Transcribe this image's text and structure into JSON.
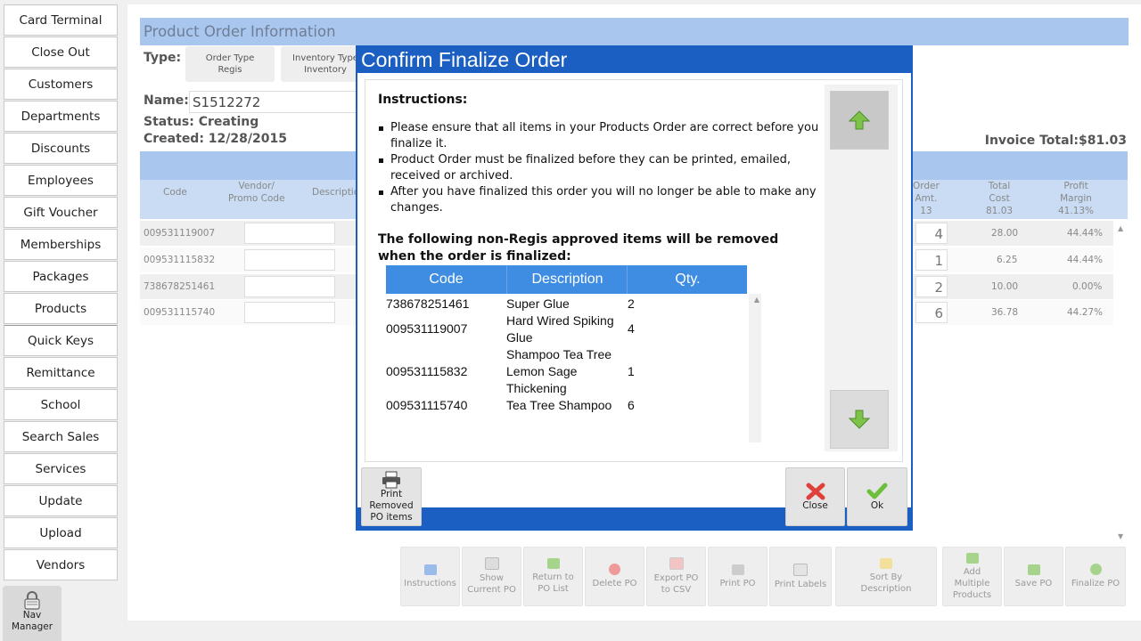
{
  "sidebar": {
    "items": [
      {
        "label": "Card Terminal"
      },
      {
        "label": "Close Out"
      },
      {
        "label": "Customers"
      },
      {
        "label": "Departments"
      },
      {
        "label": "Discounts"
      },
      {
        "label": "Employees"
      },
      {
        "label": "Gift Voucher"
      },
      {
        "label": "Memberships"
      },
      {
        "label": "Packages"
      },
      {
        "label": "Products"
      },
      {
        "label": "Quick Keys"
      },
      {
        "label": "Remittance"
      },
      {
        "label": "School"
      },
      {
        "label": "Search Sales"
      },
      {
        "label": "Services"
      },
      {
        "label": "Update"
      },
      {
        "label": "Upload"
      },
      {
        "label": "Vendors"
      }
    ],
    "nav_manager": {
      "line1": "Nav",
      "line2": "Manager",
      "icon": "lock-icon"
    }
  },
  "order": {
    "header": "Product Order Information",
    "type_label": "Type:",
    "order_type": {
      "title": "Order Type",
      "value": "Regis"
    },
    "inventory_type": {
      "title": "Inventory Type",
      "value": "Inventory"
    },
    "name_label": "Name:",
    "name_value": "S1512272",
    "status": "Status: Creating",
    "created": "Created: 12/28/2015",
    "invoice_total": "Invoice Total:$81.03"
  },
  "grid": {
    "headers": {
      "code": "Code",
      "vendor_l1": "Vendor/",
      "vendor_l2": "Promo Code",
      "description": "Description",
      "order_l1": "Order",
      "order_l2": "Amt.",
      "order_total": "13",
      "cost_l1": "Total",
      "cost_l2": "Cost",
      "cost_total": "81.03",
      "margin_l1": "Profit",
      "margin_l2": "Margin",
      "margin_total": "41.13%"
    },
    "rows": [
      {
        "code": "009531119007",
        "amt": "4",
        "cost": "28.00",
        "margin": "44.44%"
      },
      {
        "code": "009531115832",
        "amt": "1",
        "cost": "6.25",
        "margin": "44.44%"
      },
      {
        "code": "738678251461",
        "amt": "2",
        "cost": "10.00",
        "margin": "0.00%"
      },
      {
        "code": "009531115740",
        "amt": "6",
        "cost": "36.78",
        "margin": "44.27%"
      }
    ]
  },
  "toolbar": {
    "instructions": "Instructions",
    "show_current_l1": "Show",
    "show_current_l2": "Current PO",
    "return_l1": "Return to",
    "return_l2": "PO List",
    "delete": "Delete PO",
    "export_l1": "Export PO",
    "export_l2": "to CSV",
    "print": "Print PO",
    "print_labels": "Print Labels",
    "sort_l1": "Sort By",
    "sort_l2": "Description",
    "add_l1": "Add",
    "add_l2": "Multiple",
    "add_l3": "Products",
    "save": "Save PO",
    "finalize": "Finalize PO"
  },
  "modal": {
    "title": "Confirm Finalize Order",
    "instructions_title": "Instructions:",
    "instructions": [
      "Please ensure that all items in your Products Order are correct before you finalize it.",
      "Product Order must be finalized before they can be printed, emailed, received or archived.",
      "After you have finalized this order you will no longer be able to make any changes."
    ],
    "warning": "The following non-Regis approved items will be removed when the order is finalized:",
    "table_headers": {
      "code": "Code",
      "description": "Description",
      "qty": "Qty."
    },
    "removed_items": [
      {
        "code": "738678251461",
        "desc1": "Super Glue",
        "desc2": "",
        "desc3": "",
        "qty": "2"
      },
      {
        "code": "009531119007",
        "desc1": "Hard Wired Spiking",
        "desc2": "Glue",
        "desc3": "",
        "qty": "4"
      },
      {
        "code": "009531115832",
        "desc1": "Shampoo Tea Tree",
        "desc2": "Lemon Sage",
        "desc3": "Thickening",
        "qty": "1"
      },
      {
        "code": "009531115740",
        "desc1": "Tea Tree Shampoo",
        "desc2": "",
        "desc3": "",
        "qty": "6"
      }
    ],
    "print_removed_l1": "Print",
    "print_removed_l2": "Removed",
    "print_removed_l3": "PO items",
    "close": "Close",
    "ok": "Ok"
  },
  "colors": {
    "accent": "#1c5fc2",
    "header_bg": "#a9c7ee",
    "table_head": "#3f8de2",
    "close_red": "#e0403a",
    "ok_green": "#6bbf3a"
  }
}
